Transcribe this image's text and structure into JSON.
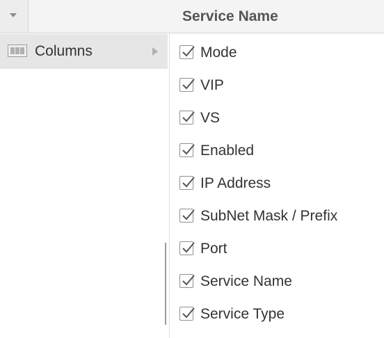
{
  "grid_header": {
    "service_name_column": "Service Name"
  },
  "column_menu": {
    "columns_label": "Columns",
    "columns_icon": "columns-icon",
    "submenu_arrow_icon": "chevron-right-icon"
  },
  "column_choices": [
    {
      "label": "Mode",
      "checked": true
    },
    {
      "label": "VIP",
      "checked": true
    },
    {
      "label": "VS",
      "checked": true
    },
    {
      "label": "Enabled",
      "checked": true
    },
    {
      "label": "IP Address",
      "checked": true
    },
    {
      "label": "SubNet Mask / Prefix",
      "checked": true
    },
    {
      "label": "Port",
      "checked": true
    },
    {
      "label": "Service Name",
      "checked": true
    },
    {
      "label": "Service Type",
      "checked": true
    }
  ],
  "colors": {
    "header_bg": "#f4f4f4",
    "menu_active_bg": "#e6e6e6",
    "text": "#333333",
    "checkbox_border": "#8f8f8f"
  }
}
